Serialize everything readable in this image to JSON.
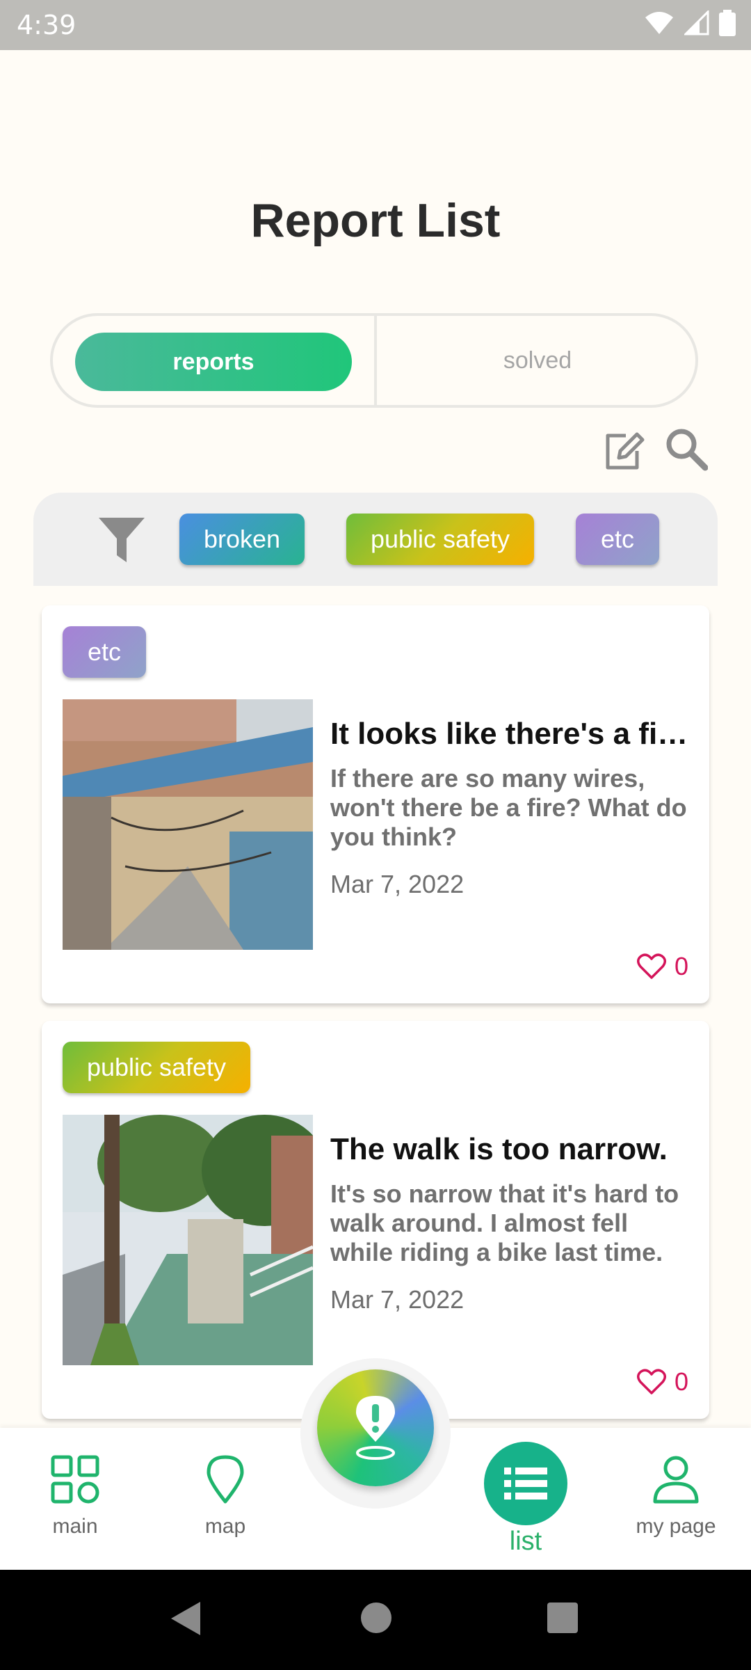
{
  "status_bar": {
    "time": "4:39"
  },
  "page": {
    "title": "Report List"
  },
  "segmented_tabs": {
    "active": "reports",
    "inactive": "solved"
  },
  "filters": {
    "chips": [
      "broken",
      "public safety",
      "etc"
    ]
  },
  "reports": [
    {
      "tag": "etc",
      "title": "It looks like there's a fi…",
      "body": "If there are so many wires, won't there be a fire? What do you think?",
      "date": "Mar 7, 2022",
      "likes": "0"
    },
    {
      "tag": "public safety",
      "title": "The walk is too narrow.",
      "body": "It's so narrow that it's hard to walk around. I almost fell while riding a bike last time.",
      "date": "Mar 7, 2022",
      "likes": "0"
    }
  ],
  "bottom_nav": {
    "main": "main",
    "map": "map",
    "list": "list",
    "mypage": "my page"
  },
  "colors": {
    "accent": "#20c67a",
    "like": "#d4145a",
    "background": "#fffcf6"
  }
}
